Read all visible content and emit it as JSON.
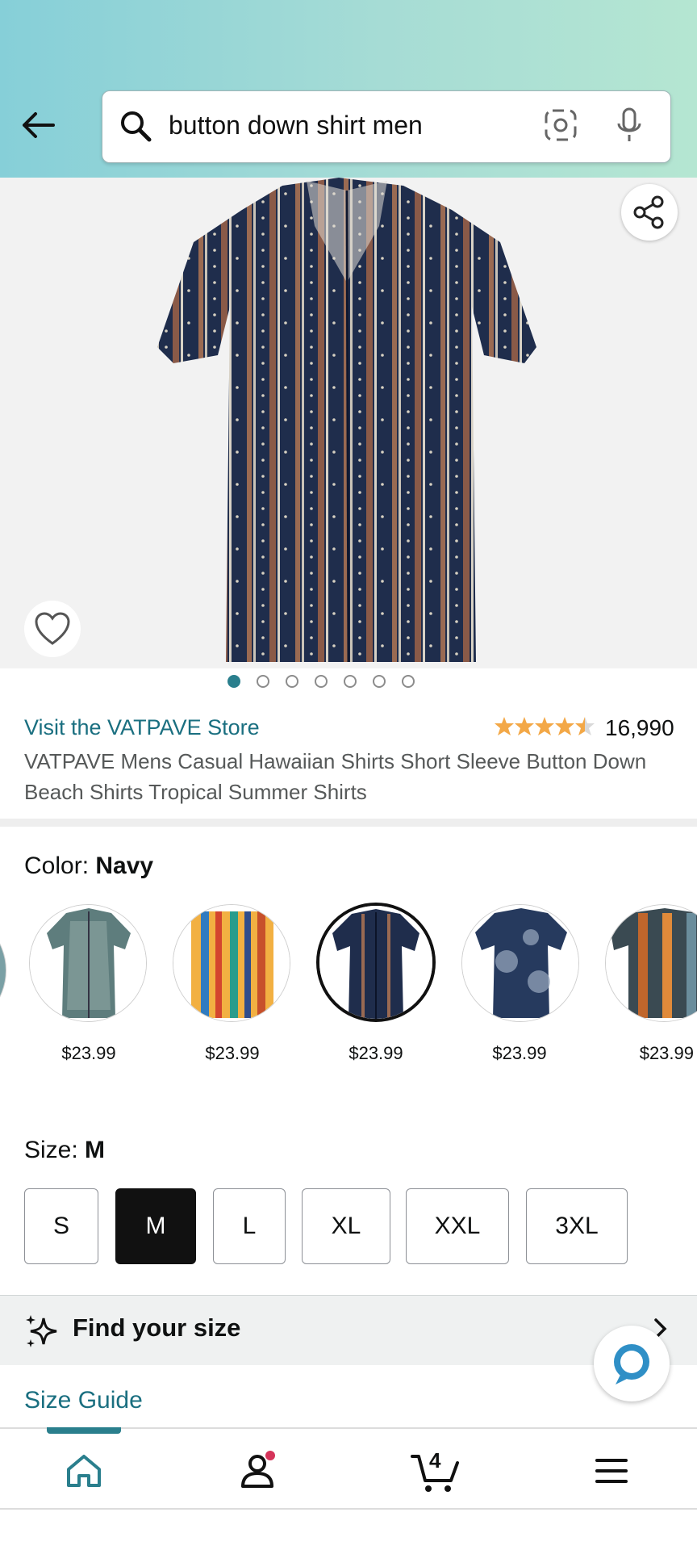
{
  "search": {
    "query": "button down shirt men"
  },
  "product": {
    "store_link": "Visit the VATPAVE Store",
    "rating_count": "16,990",
    "title": "VATPAVE Mens Casual Hawaiian Shirts Short Sleeve Button Down Beach Shirts Tropical Summer Shirts",
    "image_count": 7,
    "active_image": 0,
    "rating": 4.5
  },
  "color": {
    "label": "Color: ",
    "selected": "Navy",
    "options": [
      {
        "price": "$23.99"
      },
      {
        "price": "$23.99"
      },
      {
        "price": "$23.99"
      },
      {
        "price": "$23.99"
      },
      {
        "price": "$23.99"
      }
    ]
  },
  "size": {
    "label": "Size: ",
    "selected": "M",
    "options": [
      "S",
      "M",
      "L",
      "XL",
      "XXL",
      "3XL"
    ]
  },
  "find_size": {
    "label": "Find your size"
  },
  "size_guide": {
    "label": "Size Guide"
  },
  "cart": {
    "count": "4"
  },
  "colors": {
    "accent": "#2a7f8d",
    "link": "#1a6f80",
    "star": "#f3a847",
    "badge": "#d5345a"
  },
  "icons": [
    "back-arrow-icon",
    "search-icon",
    "camera-icon",
    "mic-icon",
    "share-icon",
    "heart-icon",
    "sparkle-icon",
    "chevron-right-icon",
    "alexa-icon",
    "home-icon",
    "account-icon",
    "cart-icon",
    "menu-icon"
  ]
}
